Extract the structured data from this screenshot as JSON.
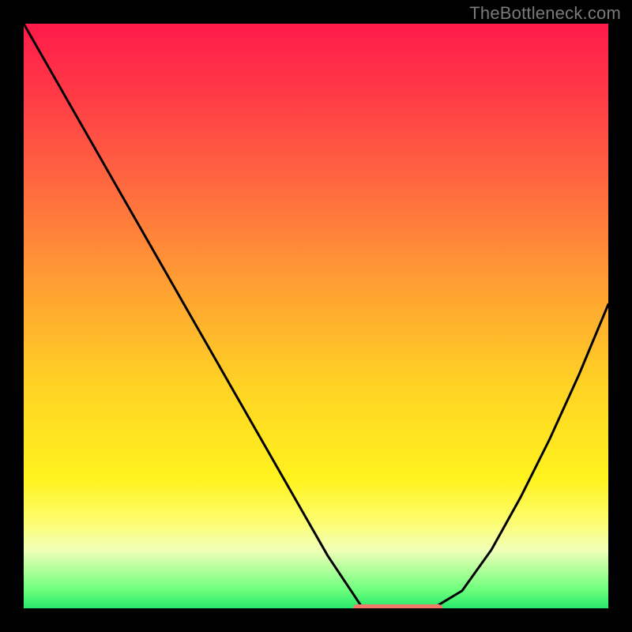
{
  "watermark": "TheBottleneck.com",
  "colors": {
    "frame": "#000000",
    "curve": "#000000",
    "sweet_spot": "#f07a6a",
    "watermark": "#7a7a7a"
  },
  "chart_data": {
    "type": "line",
    "title": "",
    "xlabel": "",
    "ylabel": "",
    "xlim": [
      0,
      100
    ],
    "ylim": [
      0,
      100
    ],
    "grid": false,
    "legend": false,
    "gradient_stops": [
      {
        "pct": 0,
        "color": "#ff1a4a"
      },
      {
        "pct": 12,
        "color": "#ff3a46"
      },
      {
        "pct": 28,
        "color": "#ff6a3f"
      },
      {
        "pct": 45,
        "color": "#ffa032"
      },
      {
        "pct": 62,
        "color": "#ffd324"
      },
      {
        "pct": 78,
        "color": "#fff31e"
      },
      {
        "pct": 85,
        "color": "#fdfd6e"
      },
      {
        "pct": 90,
        "color": "#f2ffb8"
      },
      {
        "pct": 97,
        "color": "#6aff7c"
      },
      {
        "pct": 100,
        "color": "#28e86a"
      }
    ],
    "series": [
      {
        "name": "bottleneck-curve",
        "x": [
          0,
          4,
          8,
          12,
          16,
          20,
          24,
          28,
          32,
          36,
          40,
          44,
          48,
          52,
          56,
          58,
          62,
          66,
          70,
          75,
          80,
          85,
          90,
          95,
          100
        ],
        "y": [
          100,
          93,
          86,
          79,
          72,
          65,
          58,
          51,
          44,
          37,
          30,
          23,
          16,
          9,
          3,
          0,
          0,
          0,
          0,
          3,
          10,
          19,
          29,
          40,
          52
        ]
      }
    ],
    "sweet_spot_range_x": [
      57,
      71
    ],
    "annotations": []
  }
}
